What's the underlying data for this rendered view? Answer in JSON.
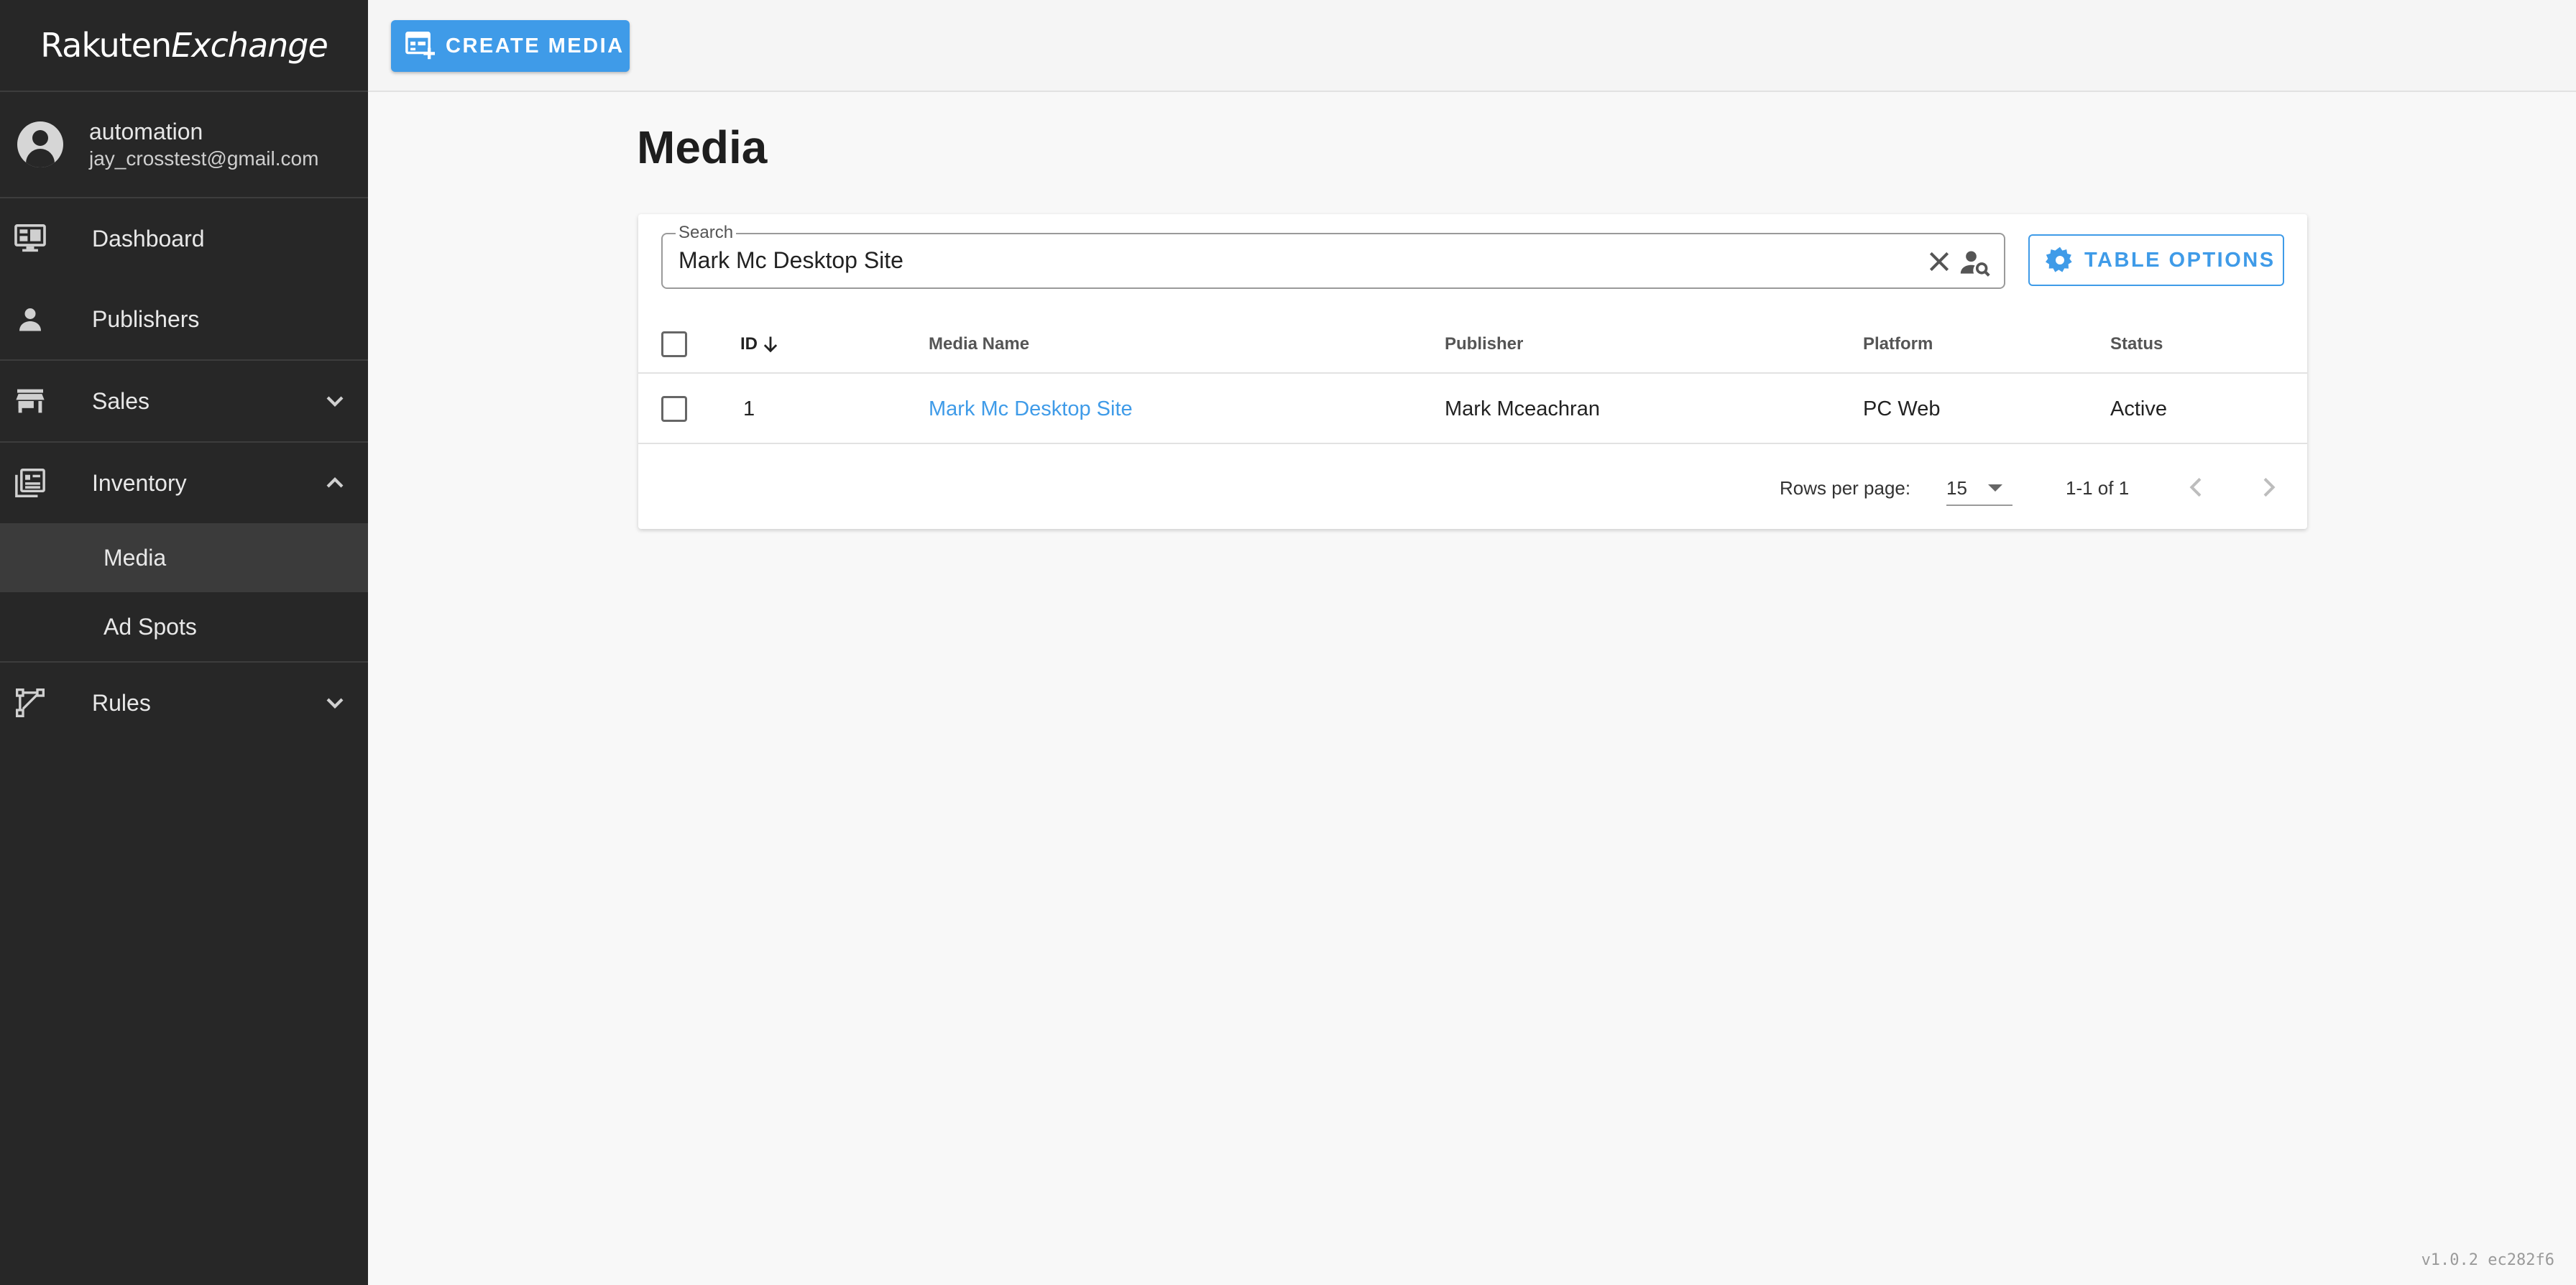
{
  "app": {
    "logo_text_a": "Rakuten",
    "logo_text_b": "Exchange",
    "version": "v1.0.2 ec282f6"
  },
  "user": {
    "name": "automation",
    "email": "jay_crosstest@gmail.com"
  },
  "sidebar": {
    "items": [
      {
        "label": "Dashboard",
        "icon": "dashboard-icon"
      },
      {
        "label": "Publishers",
        "icon": "person-icon"
      },
      {
        "label": "Sales",
        "icon": "store-icon",
        "expanded": false
      },
      {
        "label": "Inventory",
        "icon": "inventory-icon",
        "expanded": true
      },
      {
        "label": "Media",
        "active": true
      },
      {
        "label": "Ad Spots"
      },
      {
        "label": "Rules",
        "icon": "rules-icon",
        "expanded": false
      }
    ]
  },
  "toolbar": {
    "create_label": "CREATE MEDIA"
  },
  "page": {
    "title": "Media"
  },
  "search": {
    "label": "Search",
    "value": "Mark Mc Desktop Site"
  },
  "table_options_label": "TABLE OPTIONS",
  "table": {
    "columns": [
      "ID",
      "Media Name",
      "Publisher",
      "Platform",
      "Status"
    ],
    "sort": {
      "column": "ID",
      "direction": "desc"
    },
    "rows": [
      {
        "id": "1",
        "media_name": "Mark Mc Desktop Site",
        "publisher": "Mark Mceachran",
        "platform": "PC Web",
        "status": "Active"
      }
    ]
  },
  "pagination": {
    "rows_per_page_label": "Rows per page:",
    "rows_per_page": "15",
    "range": "1-1 of 1"
  },
  "colors": {
    "accent": "#3f9be8",
    "sidebar_bg": "#272727"
  }
}
